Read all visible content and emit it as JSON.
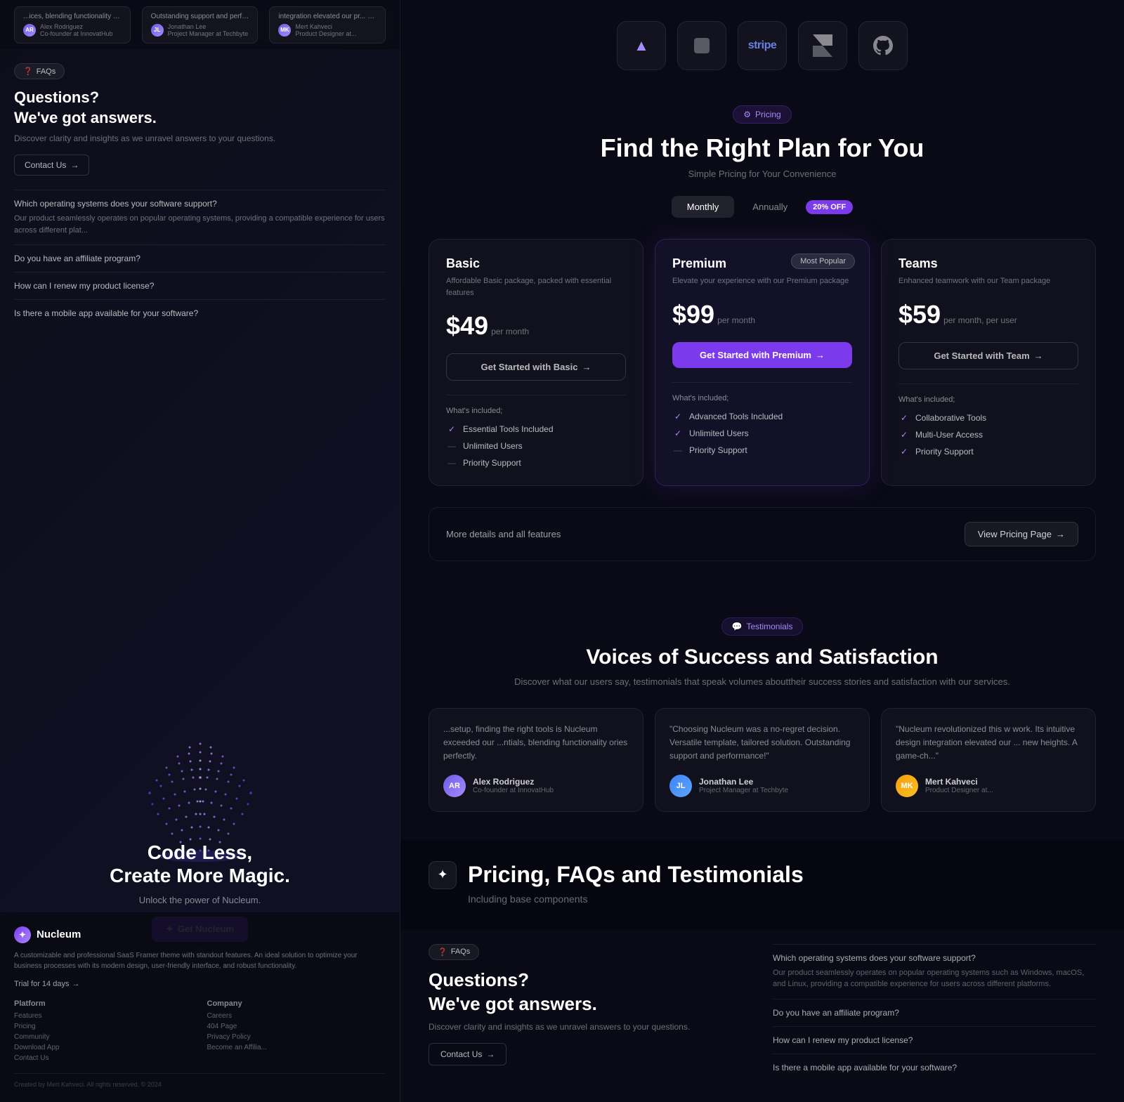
{
  "page": {
    "title": "Pricing, FAQs and Testimonials",
    "subtitle": "Including base components"
  },
  "left_panel": {
    "top_testimonials": [
      {
        "text": "...ices, blending functionality ories perfectly.",
        "author": "Alex Rodriguez",
        "role": "Co-founder at InnovatHub",
        "initials": "AR"
      },
      {
        "text": "Outstanding support and performance!",
        "author": "Jonathan Lee",
        "role": "Project Manager at Techbyte",
        "initials": "JL"
      },
      {
        "text": "integration elevated our pr... new heights. A game-sha...",
        "author": "Mert Kahveci",
        "role": "Product Designer at...",
        "initials": "MK"
      }
    ],
    "faq_badge": "FAQs",
    "faq_title": "Questions?\nWe've got answers.",
    "faq_subtitle": "Discover clarity and insights as we unravel answers to your questions.",
    "contact_btn": "Contact Us",
    "faq_questions": [
      "Which operating systems does your software support?",
      "Do you have an affiliate program?",
      "How can I renew my product license?",
      "Is there a mobile app available for your software?"
    ],
    "faq_answer_1": "Our product seamlessly operates on popular operating systems, providing a compatible experience for users across different plat...",
    "globe_visible": true,
    "cta_title": "Code Less,\nCreate More Magic.",
    "cta_subtitle": "Unlock the power of Nucleum.",
    "cta_btn": "Get Nucleum",
    "nucleum_logo": "Nucleum",
    "nucleum_desc": "A customizable and professional SaaS Framer theme with standout features. An ideal solution to optimize your business processes with its modern design, user-friendly interface, and robust functionality.",
    "trial_link": "Trial for 14 days",
    "footer": {
      "platform_col": {
        "title": "Platform",
        "links": [
          "Features",
          "Pricing",
          "Community",
          "Download App",
          "Contact Us"
        ]
      },
      "company_col": {
        "title": "Company",
        "links": [
          "Careers",
          "404 Page",
          "Privacy Policy",
          "Become an Affilia..."
        ]
      },
      "copyright": "Created by Mert Kahveci. All rights reserved. © 2024"
    }
  },
  "right_panel": {
    "logos": [
      {
        "name": "Arweave",
        "icon": "▲",
        "id": "arweave"
      },
      {
        "name": "Square",
        "icon": "⬛",
        "id": "square"
      },
      {
        "name": "Stripe",
        "icon": "stripe",
        "id": "stripe"
      },
      {
        "name": "Framer",
        "icon": "◈",
        "id": "framer"
      },
      {
        "name": "GitHub",
        "icon": "⌥",
        "id": "github"
      }
    ],
    "pricing": {
      "badge": "Pricing",
      "title": "Find the Right Plan for You",
      "subtitle": "Simple Pricing for Your Convenience",
      "billing_monthly": "Monthly",
      "billing_annually": "Annually",
      "discount_badge": "20% OFF",
      "active_billing": "monthly",
      "plans": [
        {
          "id": "basic",
          "name": "Basic",
          "desc": "Affordable Basic package, packed with essential features",
          "price": "$49",
          "period": "per month",
          "cta": "Get Started with Basic",
          "cta_style": "outline",
          "featured": false,
          "badge": null,
          "features": [
            {
              "included": true,
              "text": "Essential Tools Included"
            },
            {
              "included": false,
              "text": "Unlimited Users"
            },
            {
              "included": false,
              "text": "Priority Support"
            }
          ]
        },
        {
          "id": "premium",
          "name": "Premium",
          "desc": "Elevate your experience with our Premium package",
          "price": "$99",
          "period": "per month",
          "cta": "Get Started with Premium",
          "cta_style": "filled",
          "featured": true,
          "badge": "Most Popular",
          "features": [
            {
              "included": true,
              "text": "Advanced Tools Included"
            },
            {
              "included": true,
              "text": "Unlimited Users"
            },
            {
              "included": false,
              "text": "Priority Support"
            }
          ]
        },
        {
          "id": "teams",
          "name": "Teams",
          "desc": "Enhanced teamwork with our Team package",
          "price": "$59",
          "period": "per month, per user",
          "cta": "Get Started with Team",
          "cta_style": "outline",
          "featured": false,
          "badge": null,
          "features": [
            {
              "included": true,
              "text": "Collaborative Tools"
            },
            {
              "included": true,
              "text": "Multi-User Access"
            },
            {
              "included": true,
              "text": "Priority Support"
            }
          ]
        }
      ],
      "more_details_text": "More details and all features",
      "view_pricing_btn": "View Pricing Page"
    },
    "testimonials": {
      "badge": "Testimonials",
      "title": "Voices of Success and Satisfaction",
      "subtitle": "Discover what our users say, testimonials that speak volumes abouttheir success stories and satisfaction with our services.",
      "items": [
        {
          "text": "...setup, finding the right tools is Nucleum exceeded our ...ntials, blending functionality ories perfectly.",
          "author": "Alex Rodriguez",
          "role": "Co-founder at InnovatHub",
          "initials": "AR"
        },
        {
          "text": "\"Choosing Nucleum was a no-regret decision. Versatile template, tailored solution. Outstanding support and performance!\"",
          "author": "Jonathan Lee",
          "role": "Project Manager at Techbyte",
          "initials": "JL"
        },
        {
          "text": "\"Nucleum revolutionized this w work. Its intuitive design integration elevated our ... new heights. A game-ch...\"",
          "author": "Mert Kahveci",
          "role": "Product Designer at...",
          "initials": "MK"
        }
      ]
    },
    "page_title_overlay": {
      "title": "Pricing, FAQs and Testimonials",
      "subtitle": "Including base components"
    },
    "faqs_bottom": {
      "badge": "FAQs",
      "title": "Questions?",
      "subtitle": "We've got answers.",
      "desc": "Discover clarity and insights as we unravel answers to your questions.",
      "contact_btn": "Contact Us",
      "questions": [
        {
          "q": "Which operating systems does your software support?",
          "a": "Our product seamlessly operates on popular operating systems such as Windows, macOS, and Linux, providing a compatible experience for users across different platforms."
        },
        {
          "q": "Do you have an affiliate program?",
          "a": ""
        },
        {
          "q": "How can I renew my product license?",
          "a": ""
        },
        {
          "q": "Is there a mobile app available for your software?",
          "a": ""
        }
      ]
    }
  }
}
